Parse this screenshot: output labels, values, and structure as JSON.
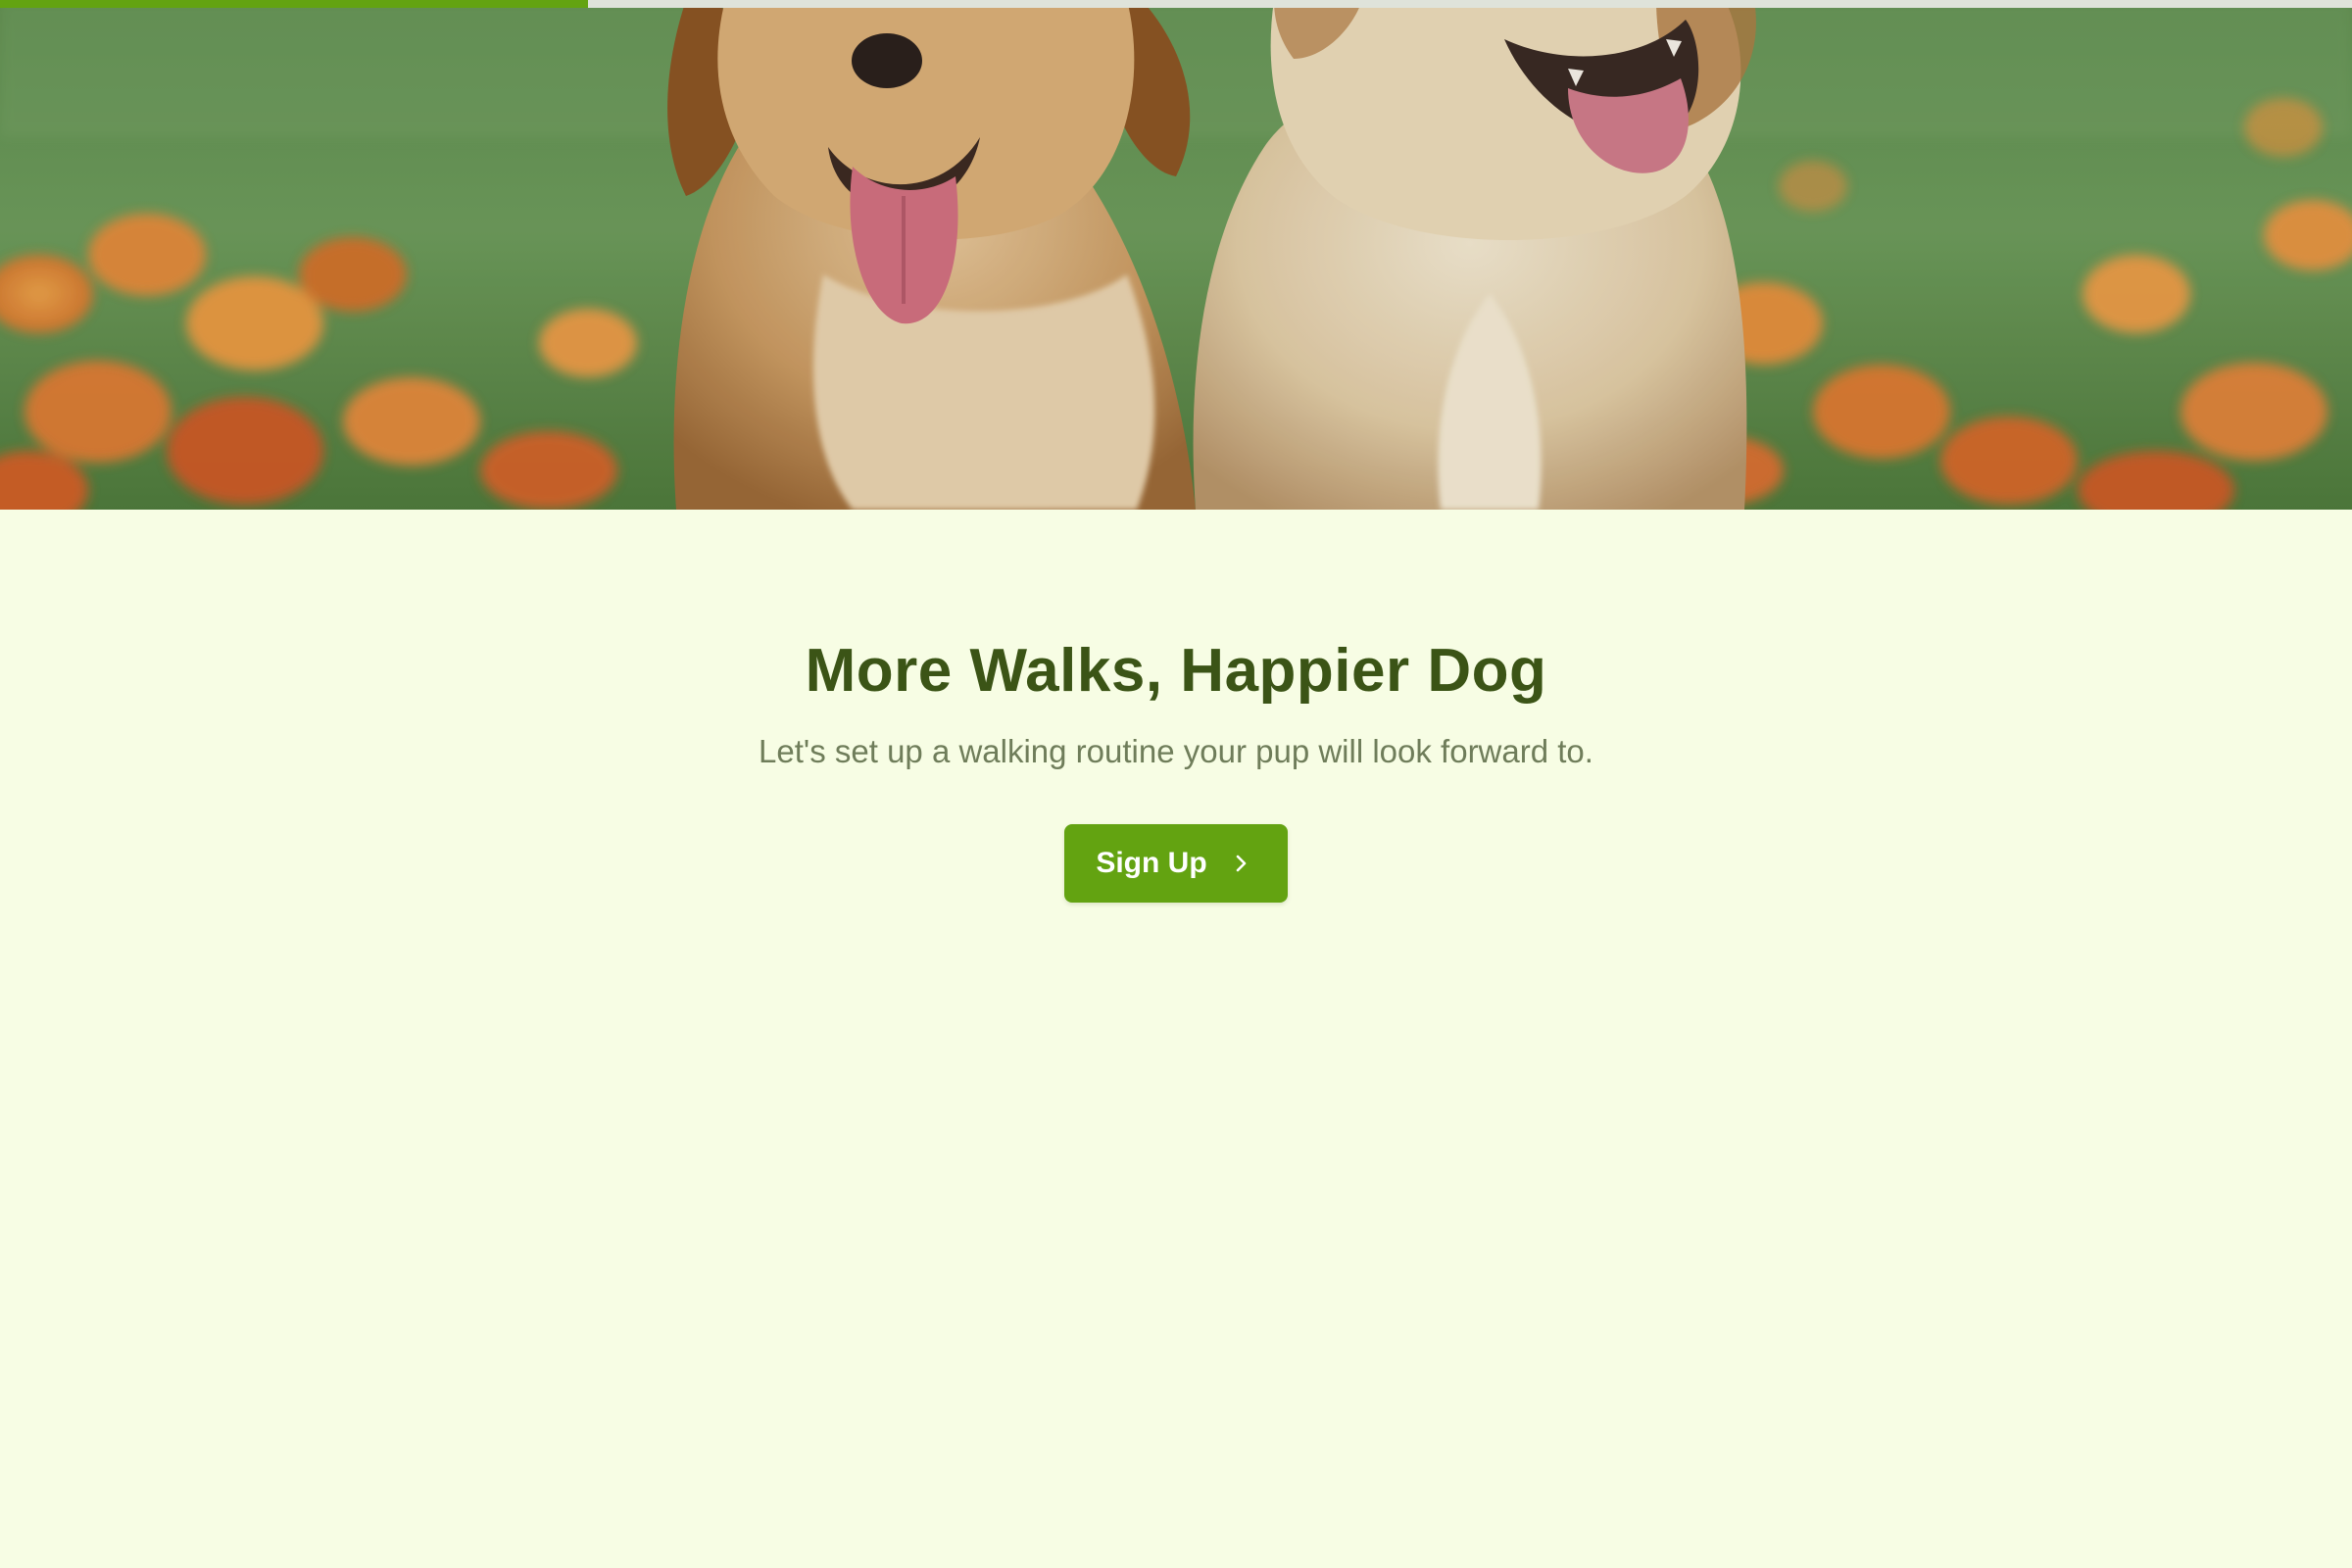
{
  "progress": {
    "value_percent": 25,
    "fill_color": "#63a311",
    "track_color": "#dfe3da"
  },
  "hero": {
    "image": "two-golden-retriever-puppies-in-flower-field"
  },
  "main": {
    "title": "More Walks, Happier Dog",
    "subtitle": "Let's set up a walking routine your pup will look forward to.",
    "cta": {
      "label": "Sign Up",
      "icon": "chevron-right-icon"
    }
  },
  "colors": {
    "background": "#f7fde4",
    "title": "#3b5416",
    "subtitle": "#6f7d5a",
    "button": "#63a311",
    "button_text": "#ffffff"
  }
}
